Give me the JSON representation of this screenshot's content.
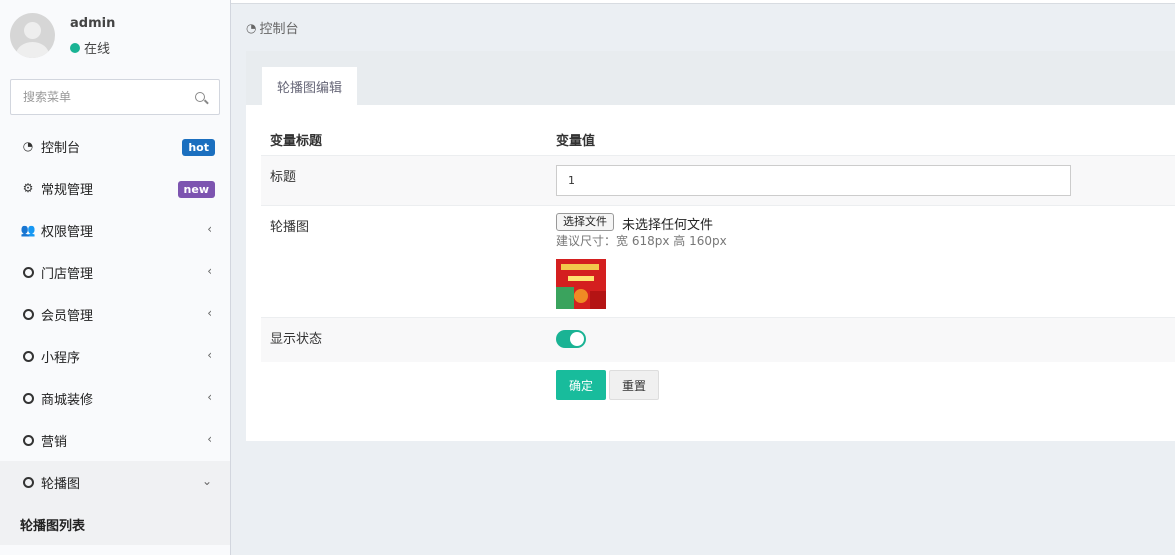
{
  "user": {
    "name": "admin",
    "status": "在线",
    "status_color": "#1ab394"
  },
  "search": {
    "placeholder": "搜索菜单"
  },
  "menu": {
    "items": [
      {
        "label": "控制台",
        "icon": "dashboard-icon",
        "badge": "hot"
      },
      {
        "label": "常规管理",
        "icon": "cogs-icon",
        "badge": "new"
      },
      {
        "label": "权限管理",
        "icon": "users-icon"
      },
      {
        "label": "门店管理",
        "icon": "circle-icon"
      },
      {
        "label": "会员管理",
        "icon": "circle-icon"
      },
      {
        "label": "小程序",
        "icon": "circle-icon"
      },
      {
        "label": "商城装修",
        "icon": "circle-icon"
      },
      {
        "label": "营销",
        "icon": "circle-icon"
      },
      {
        "label": "轮播图",
        "icon": "circle-icon",
        "expanded": true
      }
    ],
    "subitems": [
      {
        "label": "轮播图列表"
      }
    ]
  },
  "breadcrumb": {
    "label": "控制台"
  },
  "panel": {
    "tab": "轮播图编辑",
    "header": {
      "col1": "变量标题",
      "col2": "变量值"
    },
    "fields": {
      "title": {
        "label": "标题",
        "value": "1"
      },
      "image": {
        "label": "轮播图",
        "button": "选择文件",
        "file_text": "未选择任何文件",
        "hint": "建议尺寸：宽 618px 高 160px"
      },
      "status": {
        "label": "显示状态",
        "enabled": true
      }
    },
    "buttons": {
      "ok": "确定",
      "reset": "重置"
    }
  },
  "colors": {
    "primary": "#18bc9c",
    "hot_badge": "#1b6fbf",
    "new_badge": "#7d54b0"
  }
}
